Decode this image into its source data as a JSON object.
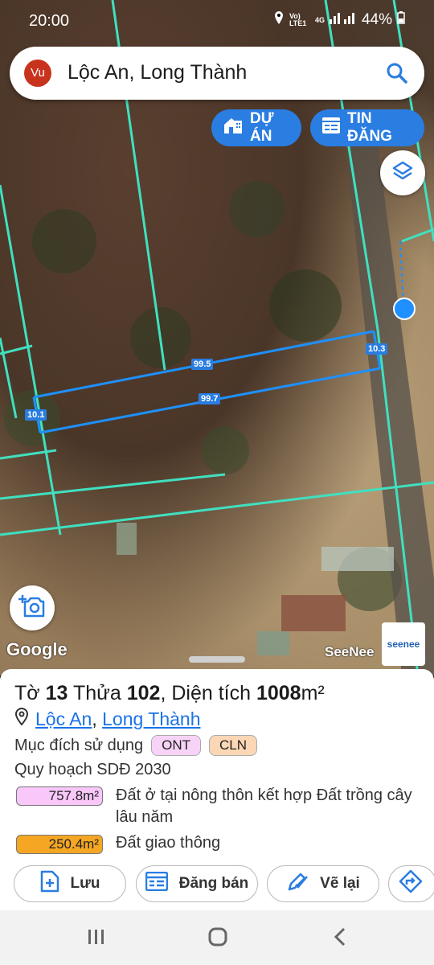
{
  "status_bar": {
    "time": "20:00",
    "network": "Vo) LTE1",
    "signal_type": "4G",
    "battery": "44%"
  },
  "search": {
    "avatar": "Vu",
    "query": "Lộc An, Long Thành",
    "icon": "search-icon"
  },
  "map_buttons": {
    "du_an": "DỰ ÁN",
    "tin_dang": "TIN ĐĂNG"
  },
  "map": {
    "measurements": {
      "top": "99.5",
      "bottom": "99.7",
      "left": "10.1",
      "right": "10.3"
    },
    "google_label": "Google",
    "seenee_label": "SeeNee",
    "seenee_logo": "seenee",
    "colors": {
      "parcel_line": "#40e0c0",
      "selected_line": "#1e90ff"
    }
  },
  "parcel": {
    "prefix_sheet": "Tờ",
    "sheet": "13",
    "prefix_lot": "Thửa",
    "lot": "102",
    "prefix_area": ", Diện tích",
    "area": "1008",
    "area_unit": "m²",
    "commune": "Lộc An",
    "separator": ",",
    "district": "Long Thành",
    "purpose_label": "Mục đích sử dụng",
    "tags": [
      {
        "code": "ONT",
        "color": "#f7d4f7"
      },
      {
        "code": "CLN",
        "color": "#fcd7b6"
      }
    ],
    "plan_label": "Quy hoạch SDĐ 2030",
    "zones": [
      {
        "area": "757.8m²",
        "desc": "Đất ở tại nông thôn kết hợp Đất trồng cây lâu năm",
        "color": "#f9c7f9"
      },
      {
        "area": "250.4m²",
        "desc": "Đất giao thông",
        "color": "#f5a623"
      }
    ]
  },
  "actions": {
    "save": "Lưu",
    "post": "Đăng bán",
    "redraw": "Vẽ lại"
  }
}
